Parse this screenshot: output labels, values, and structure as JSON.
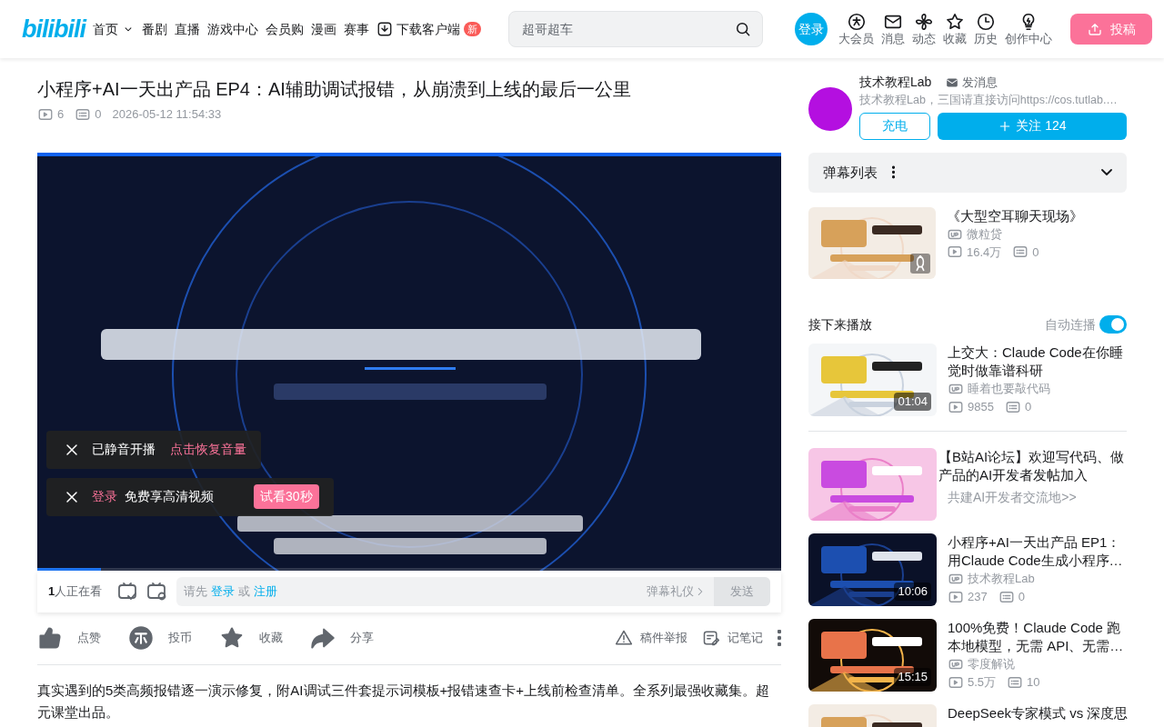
{
  "header": {
    "logo": "bilibili",
    "nav": [
      {
        "label": "首页",
        "kind": "menu"
      },
      {
        "label": "番剧",
        "kind": "link"
      },
      {
        "label": "直播",
        "kind": "link"
      },
      {
        "label": "游戏中心",
        "kind": "link"
      },
      {
        "label": "会员购",
        "kind": "link"
      },
      {
        "label": "漫画",
        "kind": "link"
      },
      {
        "label": "赛事",
        "kind": "link"
      },
      {
        "label": "下载客户端",
        "kind": "download",
        "badge": "新"
      }
    ],
    "search": {
      "placeholder": "超哥超车"
    },
    "login": "登录",
    "icons": [
      {
        "label": "大会员",
        "kind": "vip"
      },
      {
        "label": "消息",
        "kind": "mail"
      },
      {
        "label": "动态",
        "kind": "fan"
      },
      {
        "label": "收藏",
        "kind": "star"
      },
      {
        "label": "历史",
        "kind": "clock"
      },
      {
        "label": "创作中心",
        "kind": "bulb"
      }
    ],
    "upload": "投稿"
  },
  "video": {
    "title": "小程序+AI一天出产品 EP4：AI辅助调试报错，从崩溃到上线的最后一公里",
    "plays": "6",
    "danmaku": "0",
    "date": "2026-05-12 11:54:33",
    "notices": [
      {
        "kind": "muted",
        "text": "已静音开播",
        "link": "点击恢复音量"
      },
      {
        "kind": "login",
        "link": "登录",
        "text": "免费享高清视频",
        "button": "试看30秒"
      }
    ],
    "progress": {
      "level": 0.085
    },
    "viewers": {
      "count": "1",
      "text": "人正在看"
    },
    "danmaku_input": {
      "prefix": "请先",
      "login": "登录",
      "or": "或",
      "register": "注册",
      "etiquette": "弹幕礼仪",
      "send": "发送"
    },
    "actions": [
      {
        "label": "点赞",
        "kind": "like"
      },
      {
        "label": "投币",
        "kind": "coin"
      },
      {
        "label": "收藏",
        "kind": "star"
      },
      {
        "label": "分享",
        "kind": "share"
      }
    ],
    "tools": [
      {
        "label": "稿件举报",
        "kind": "report"
      },
      {
        "label": "记笔记",
        "kind": "note"
      }
    ],
    "description": "真实遇到的5类高频报错逐一演示修复，附AI调试三件套提示词模板+报错速查卡+上线前检查清单。全系列最强收藏集。超元课堂出品。"
  },
  "uploader": {
    "name": "技术教程Lab",
    "message": "发消息",
    "bio": "技术教程Lab，三国请直接访问https://cos.tutlab.…",
    "charge": "充电",
    "follow": "关注 124"
  },
  "danmaku_list": {
    "title": "弹幕列表"
  },
  "ad": {
    "title": "《大型空耳聊天现场》",
    "up": "微粒贷",
    "plays": "16.4万",
    "danmaku": "0"
  },
  "up_next": {
    "title": "接下来播放",
    "autoplay": {
      "label": "自动连播",
      "on": true
    },
    "items": [
      {
        "kind": "video",
        "title": "上交大：Claude Code在你睡觉时做靠谱科研",
        "duration": "01:04",
        "up": "睡着也要敲代码",
        "plays": "9855",
        "danmaku": "0"
      },
      {
        "kind": "promo",
        "title": "【B站AI论坛】欢迎写代码、做产品的AI开发者发帖加入",
        "subtitle": "共建AI开发者交流地>>"
      },
      {
        "kind": "video",
        "title": "小程序+AI一天出产品 EP1：用Claude Code生成小程序…",
        "duration": "10:06",
        "up": "技术教程Lab",
        "plays": "237",
        "danmaku": "0"
      },
      {
        "kind": "video",
        "title": "100%免费！Claude Code 跑本地模型，无需 API、无需…",
        "duration": "15:15",
        "up": "零度解说",
        "plays": "5.5万",
        "danmaku": "10"
      },
      {
        "kind": "video",
        "title": "DeepSeek专家模式 vs 深度思"
      }
    ]
  }
}
